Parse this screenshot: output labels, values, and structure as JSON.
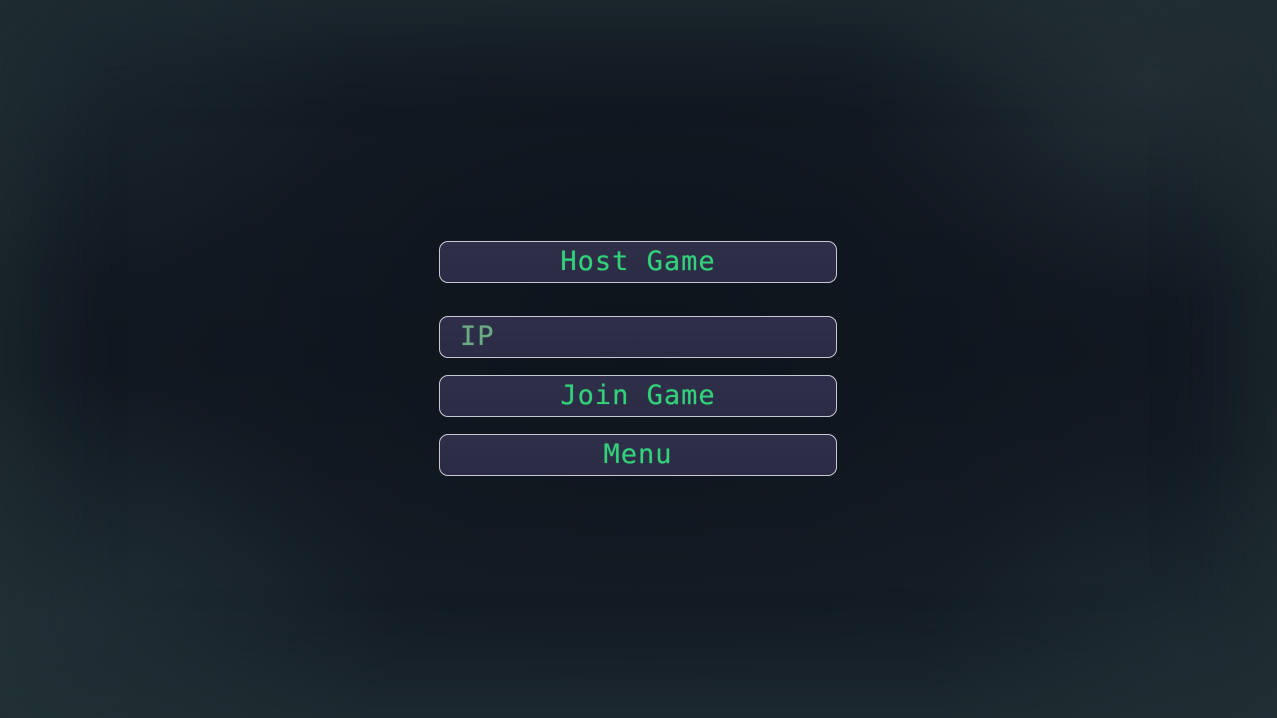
{
  "menu": {
    "host_label": "Host Game",
    "ip_placeholder": "IP",
    "ip_value": "",
    "join_label": "Join Game",
    "menu_label": "Menu"
  },
  "colors": {
    "text_accent": "#33d17a",
    "button_fill": "#2d2d48",
    "button_border": "#c8c8d4",
    "background": "#121a24"
  }
}
